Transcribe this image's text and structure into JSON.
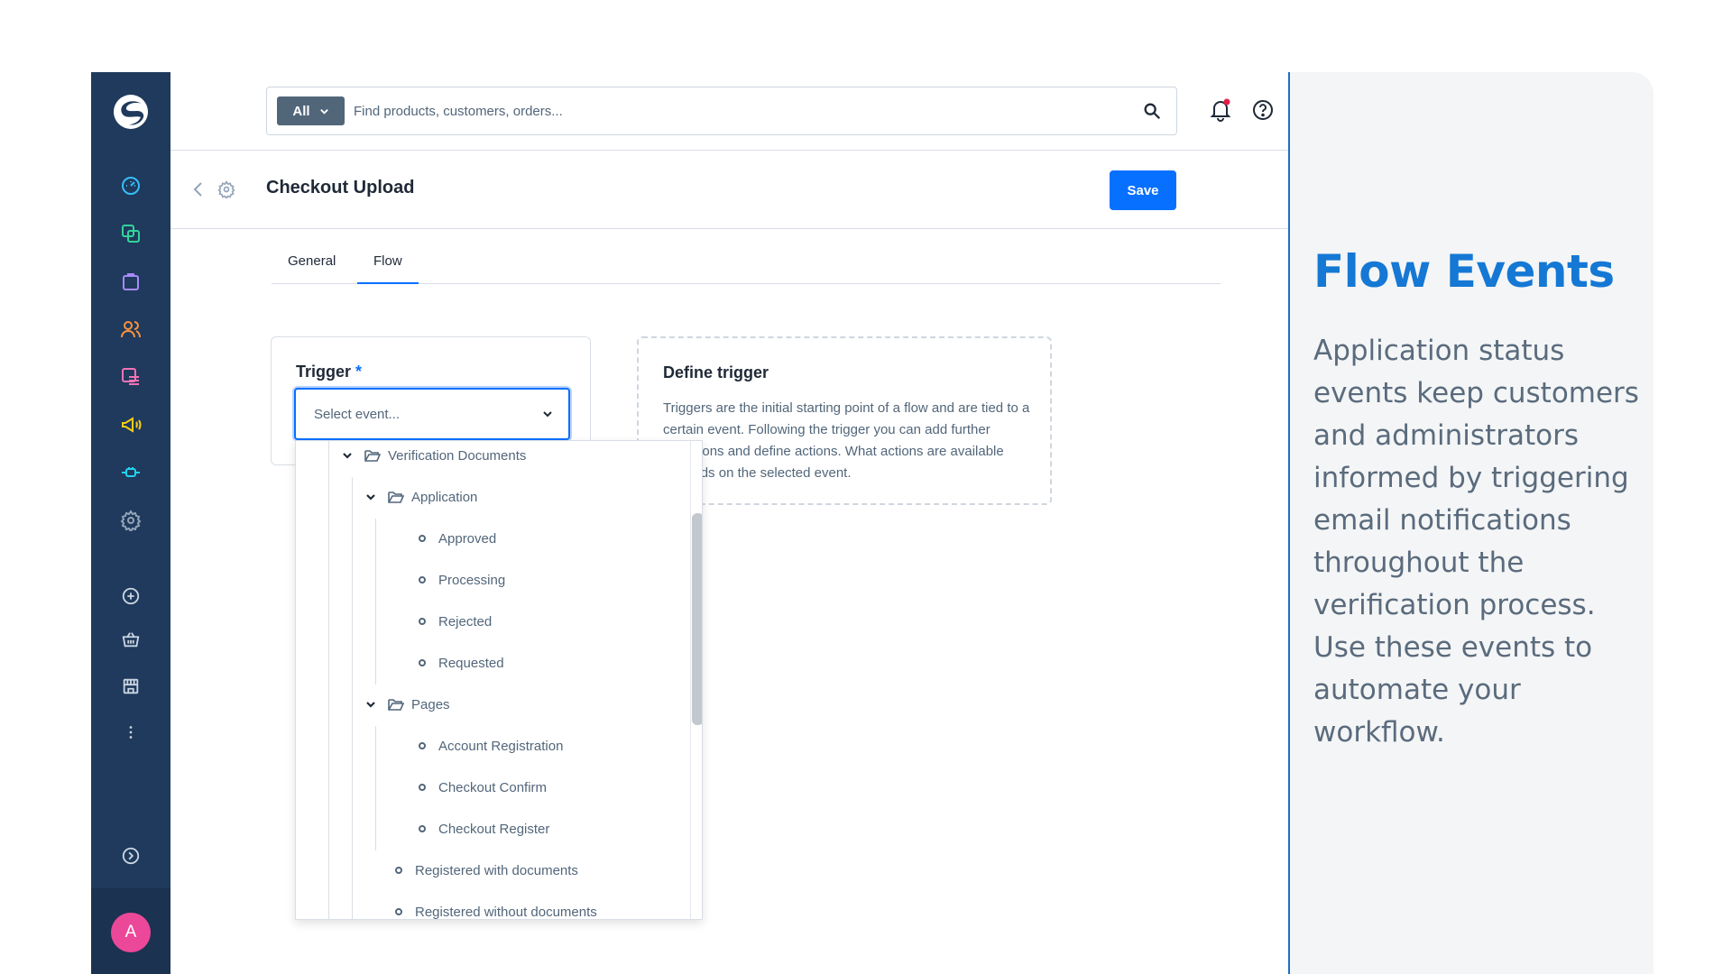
{
  "search": {
    "scope_label": "All",
    "placeholder": "Find products, customers, orders..."
  },
  "page": {
    "title": "Checkout Upload",
    "save_label": "Save"
  },
  "tabs": [
    {
      "label": "General"
    },
    {
      "label": "Flow"
    }
  ],
  "trigger": {
    "label": "Trigger",
    "required_mark": "*",
    "select_placeholder": "Select event..."
  },
  "define_trigger": {
    "title": "Define trigger",
    "text": "Triggers are the initial starting point of a flow and are tied to a certain event. Following the trigger you can add further conditions and define actions. What actions are available depends on the selected event."
  },
  "tree": {
    "root": "Verification Documents",
    "application": "Application",
    "application_items": [
      "Approved",
      "Processing",
      "Rejected",
      "Requested"
    ],
    "pages": "Pages",
    "pages_items": [
      "Account Registration",
      "Checkout Confirm",
      "Checkout Register"
    ],
    "registered_with": "Registered with documents",
    "registered_without": "Registered without documents"
  },
  "user": {
    "avatar_initial": "A"
  },
  "panel": {
    "title": "Flow Events",
    "text": "Application status events keep customers and administrators informed by triggering email notifications throughout the verification process. Use these events to automate your workflow."
  },
  "colors": {
    "sidebar": "#1f3a5c",
    "accent": "#0870ff",
    "panel_title": "#1478d4",
    "avatar": "#ec4899"
  }
}
